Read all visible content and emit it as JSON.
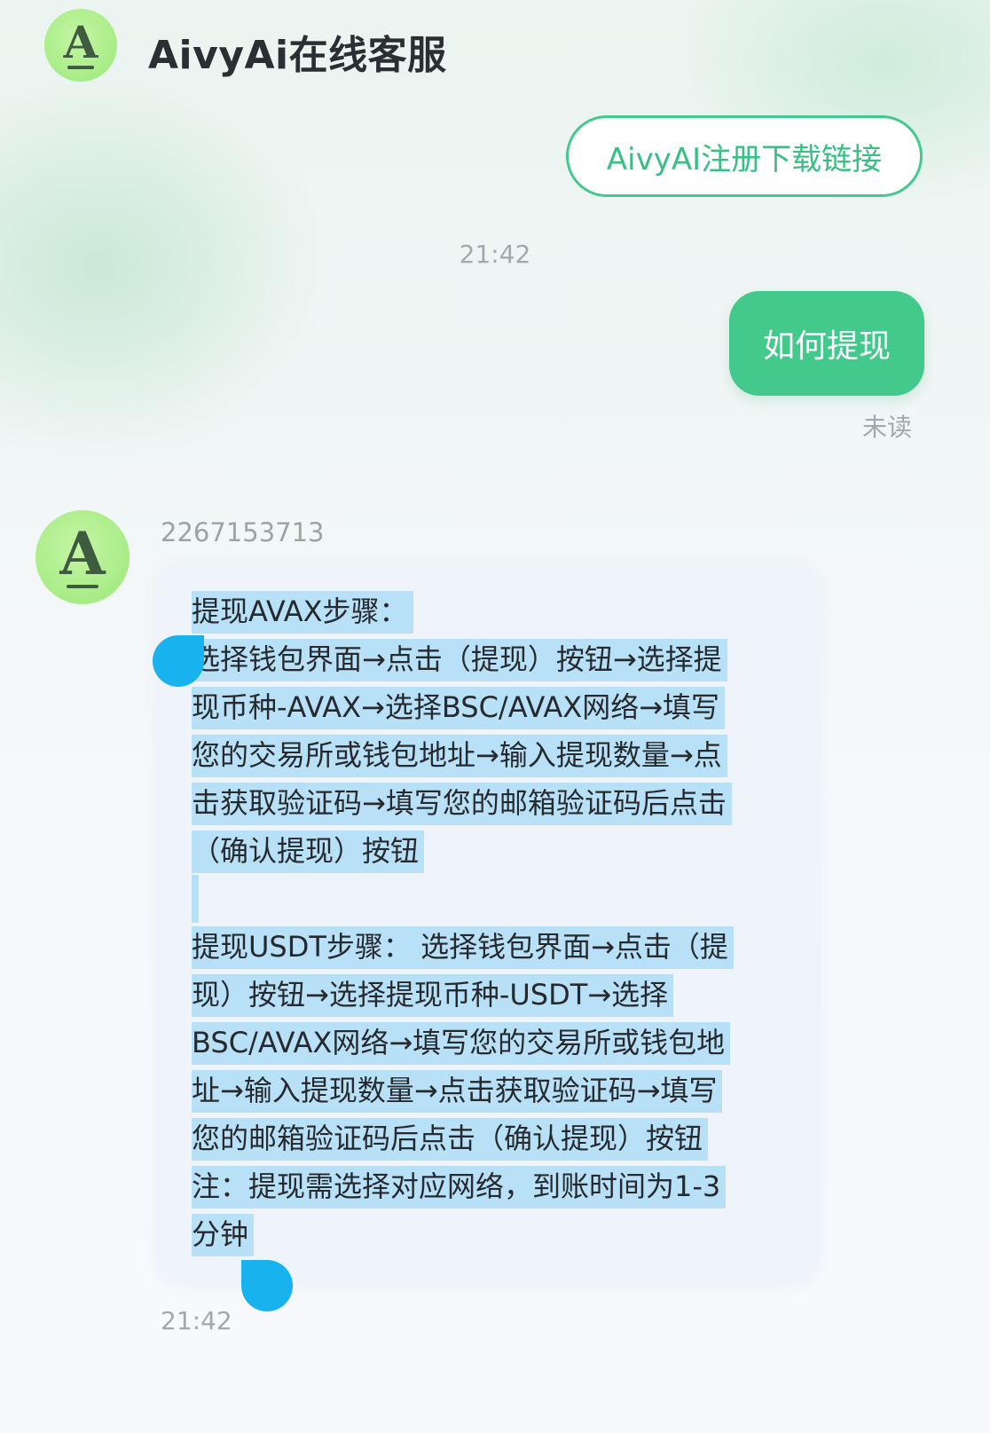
{
  "header": {
    "title": "AivyAi在线客服",
    "avatar_letter": "A"
  },
  "messages": {
    "link_bubble": "AivyAI注册下载链接",
    "time_1": "21:42",
    "user_message": "如何提现",
    "user_status": "未读",
    "bot_avatar_letter": "A",
    "bot_sender_id": "2267153713",
    "bot_lines": [
      "提现AVAX步骤：",
      "选择钱包界面→点击（提现）按钮→选择提",
      "现币种-AVAX→选择BSC/AVAX网络→填写",
      "您的交易所或钱包地址→输入提现数量→点",
      "击获取验证码→填写您的邮箱验证码后点击",
      "（确认提现）按钮",
      "",
      "提现USDT步骤： 选择钱包界面→点击（提",
      "现）按钮→选择提现币种-USDT→选择",
      "BSC/AVAX网络→填写您的交易所或钱包地",
      "址→输入提现数量→点击获取验证码→填写",
      "您的邮箱验证码后点击（确认提现）按钮",
      "注：提现需选择对应网络，到账时间为1-3",
      "分钟"
    ],
    "time_2": "21:42"
  },
  "colors": {
    "brand_green": "#43c98c",
    "avatar_green": "#a8ec86",
    "selection_highlight": "#b8e0f7",
    "selection_handle": "#18b3ef"
  },
  "icons": {
    "header_avatar": "aivy-logo-icon",
    "bot_avatar": "aivy-logo-icon"
  }
}
